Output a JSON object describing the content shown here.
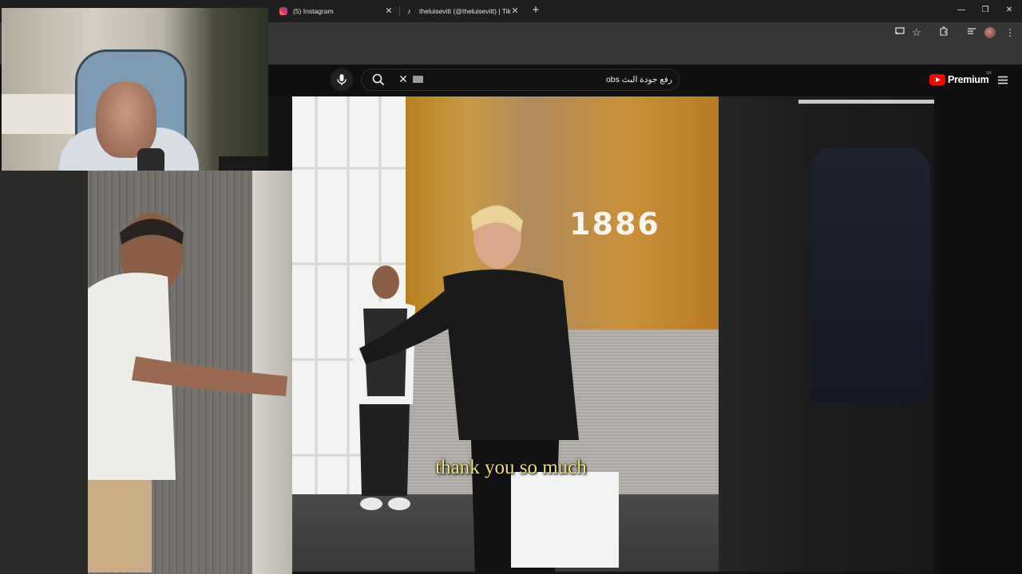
{
  "browser": {
    "tabs": [
      {
        "title": "(5) Instagram",
        "icon": "instagram-icon"
      },
      {
        "title": "theluisevitt (@theluisevitt) | Tik",
        "icon": "tiktok-icon"
      }
    ],
    "new_tab": "+",
    "window_controls": {
      "minimize": "—",
      "maximize": "❐",
      "close": "✕"
    },
    "tab_close": "✕",
    "toolbar_icons": [
      "cast-icon",
      "bookmark-star-icon",
      "extensions-icon",
      "reading-list-icon",
      "profile-avatar",
      "more-icon"
    ]
  },
  "youtube": {
    "search": {
      "query": "رفع جودة البث obs",
      "clear": "✕"
    },
    "logo_text": "Premium",
    "region": "SA"
  },
  "video": {
    "subtitle": "thank you so much",
    "sign_text": "1886"
  },
  "colors": {
    "chrome_bg": "#1f1f1f",
    "toolbar_bg": "#353535",
    "page_bg": "#0f0f0f",
    "youtube_red": "#ff0000",
    "subtitle": "#f2df73"
  }
}
